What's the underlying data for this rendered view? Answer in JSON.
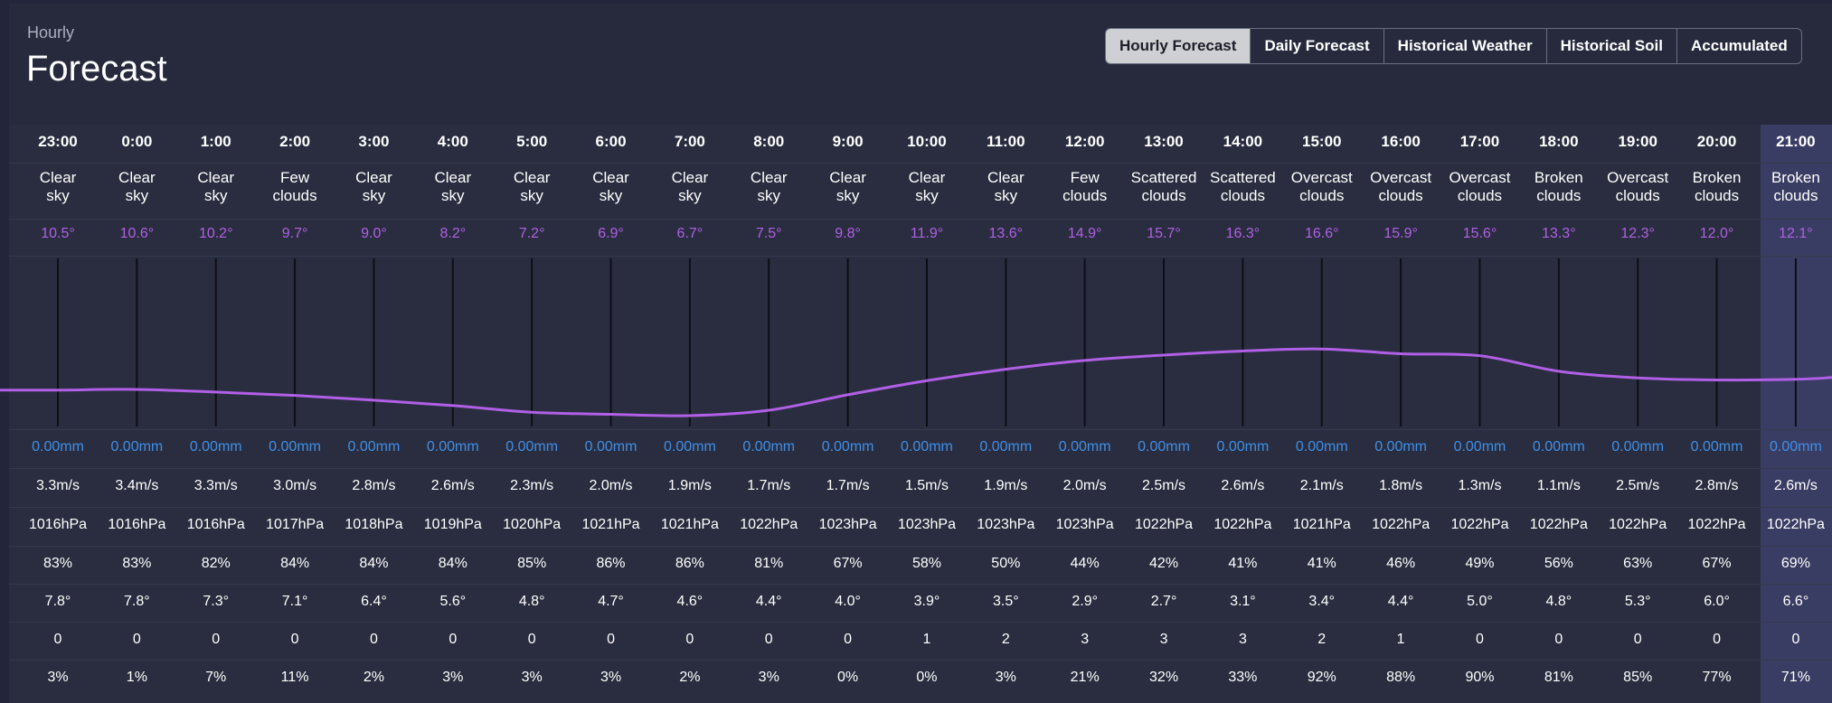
{
  "header": {
    "subtitle": "Hourly",
    "title": "Forecast"
  },
  "tabs": [
    "Hourly Forecast",
    "Daily Forecast",
    "Historical Weather",
    "Historical Soil",
    "Accumulated"
  ],
  "active_tab": "Hourly Forecast",
  "colors": {
    "temperature": "#b15fe6",
    "precipitation": "#3f8fe8",
    "highlight_column": "#3a3d63"
  },
  "hours": [
    {
      "time": "23:00",
      "desc": [
        "Clear",
        "sky"
      ],
      "temp": "10.5°",
      "precip": "0.00mm",
      "wind": "3.3m/s",
      "pressure": "1016hPa",
      "humidity": "83%",
      "dew": "7.8°",
      "uv": "0",
      "clouds": "3%"
    },
    {
      "time": "0:00",
      "desc": [
        "Clear",
        "sky"
      ],
      "temp": "10.6°",
      "precip": "0.00mm",
      "wind": "3.4m/s",
      "pressure": "1016hPa",
      "humidity": "83%",
      "dew": "7.8°",
      "uv": "0",
      "clouds": "1%"
    },
    {
      "time": "1:00",
      "desc": [
        "Clear",
        "sky"
      ],
      "temp": "10.2°",
      "precip": "0.00mm",
      "wind": "3.3m/s",
      "pressure": "1016hPa",
      "humidity": "82%",
      "dew": "7.3°",
      "uv": "0",
      "clouds": "7%"
    },
    {
      "time": "2:00",
      "desc": [
        "Few",
        "clouds"
      ],
      "temp": "9.7°",
      "precip": "0.00mm",
      "wind": "3.0m/s",
      "pressure": "1017hPa",
      "humidity": "84%",
      "dew": "7.1°",
      "uv": "0",
      "clouds": "11%"
    },
    {
      "time": "3:00",
      "desc": [
        "Clear",
        "sky"
      ],
      "temp": "9.0°",
      "precip": "0.00mm",
      "wind": "2.8m/s",
      "pressure": "1018hPa",
      "humidity": "84%",
      "dew": "6.4°",
      "uv": "0",
      "clouds": "2%"
    },
    {
      "time": "4:00",
      "desc": [
        "Clear",
        "sky"
      ],
      "temp": "8.2°",
      "precip": "0.00mm",
      "wind": "2.6m/s",
      "pressure": "1019hPa",
      "humidity": "84%",
      "dew": "5.6°",
      "uv": "0",
      "clouds": "3%"
    },
    {
      "time": "5:00",
      "desc": [
        "Clear",
        "sky"
      ],
      "temp": "7.2°",
      "precip": "0.00mm",
      "wind": "2.3m/s",
      "pressure": "1020hPa",
      "humidity": "85%",
      "dew": "4.8°",
      "uv": "0",
      "clouds": "3%"
    },
    {
      "time": "6:00",
      "desc": [
        "Clear",
        "sky"
      ],
      "temp": "6.9°",
      "precip": "0.00mm",
      "wind": "2.0m/s",
      "pressure": "1021hPa",
      "humidity": "86%",
      "dew": "4.7°",
      "uv": "0",
      "clouds": "3%"
    },
    {
      "time": "7:00",
      "desc": [
        "Clear",
        "sky"
      ],
      "temp": "6.7°",
      "precip": "0.00mm",
      "wind": "1.9m/s",
      "pressure": "1021hPa",
      "humidity": "86%",
      "dew": "4.6°",
      "uv": "0",
      "clouds": "2%"
    },
    {
      "time": "8:00",
      "desc": [
        "Clear",
        "sky"
      ],
      "temp": "7.5°",
      "precip": "0.00mm",
      "wind": "1.7m/s",
      "pressure": "1022hPa",
      "humidity": "81%",
      "dew": "4.4°",
      "uv": "0",
      "clouds": "3%"
    },
    {
      "time": "9:00",
      "desc": [
        "Clear",
        "sky"
      ],
      "temp": "9.8°",
      "precip": "0.00mm",
      "wind": "1.7m/s",
      "pressure": "1023hPa",
      "humidity": "67%",
      "dew": "4.0°",
      "uv": "0",
      "clouds": "0%"
    },
    {
      "time": "10:00",
      "desc": [
        "Clear",
        "sky"
      ],
      "temp": "11.9°",
      "precip": "0.00mm",
      "wind": "1.5m/s",
      "pressure": "1023hPa",
      "humidity": "58%",
      "dew": "3.9°",
      "uv": "1",
      "clouds": "0%"
    },
    {
      "time": "11:00",
      "desc": [
        "Clear",
        "sky"
      ],
      "temp": "13.6°",
      "precip": "0.00mm",
      "wind": "1.9m/s",
      "pressure": "1023hPa",
      "humidity": "50%",
      "dew": "3.5°",
      "uv": "2",
      "clouds": "3%"
    },
    {
      "time": "12:00",
      "desc": [
        "Few",
        "clouds"
      ],
      "temp": "14.9°",
      "precip": "0.00mm",
      "wind": "2.0m/s",
      "pressure": "1023hPa",
      "humidity": "44%",
      "dew": "2.9°",
      "uv": "3",
      "clouds": "21%"
    },
    {
      "time": "13:00",
      "desc": [
        "Scattered",
        "clouds"
      ],
      "temp": "15.7°",
      "precip": "0.00mm",
      "wind": "2.5m/s",
      "pressure": "1022hPa",
      "humidity": "42%",
      "dew": "2.7°",
      "uv": "3",
      "clouds": "32%"
    },
    {
      "time": "14:00",
      "desc": [
        "Scattered",
        "clouds"
      ],
      "temp": "16.3°",
      "precip": "0.00mm",
      "wind": "2.6m/s",
      "pressure": "1022hPa",
      "humidity": "41%",
      "dew": "3.1°",
      "uv": "3",
      "clouds": "33%"
    },
    {
      "time": "15:00",
      "desc": [
        "Overcast",
        "clouds"
      ],
      "temp": "16.6°",
      "precip": "0.00mm",
      "wind": "2.1m/s",
      "pressure": "1021hPa",
      "humidity": "41%",
      "dew": "3.4°",
      "uv": "2",
      "clouds": "92%"
    },
    {
      "time": "16:00",
      "desc": [
        "Overcast",
        "clouds"
      ],
      "temp": "15.9°",
      "precip": "0.00mm",
      "wind": "1.8m/s",
      "pressure": "1022hPa",
      "humidity": "46%",
      "dew": "4.4°",
      "uv": "1",
      "clouds": "88%"
    },
    {
      "time": "17:00",
      "desc": [
        "Overcast",
        "clouds"
      ],
      "temp": "15.6°",
      "precip": "0.00mm",
      "wind": "1.3m/s",
      "pressure": "1022hPa",
      "humidity": "49%",
      "dew": "5.0°",
      "uv": "0",
      "clouds": "90%"
    },
    {
      "time": "18:00",
      "desc": [
        "Broken",
        "clouds"
      ],
      "temp": "13.3°",
      "precip": "0.00mm",
      "wind": "1.1m/s",
      "pressure": "1022hPa",
      "humidity": "56%",
      "dew": "4.8°",
      "uv": "0",
      "clouds": "81%"
    },
    {
      "time": "19:00",
      "desc": [
        "Overcast",
        "clouds"
      ],
      "temp": "12.3°",
      "precip": "0.00mm",
      "wind": "2.5m/s",
      "pressure": "1022hPa",
      "humidity": "63%",
      "dew": "5.3°",
      "uv": "0",
      "clouds": "85%"
    },
    {
      "time": "20:00",
      "desc": [
        "Broken",
        "clouds"
      ],
      "temp": "12.0°",
      "precip": "0.00mm",
      "wind": "2.8m/s",
      "pressure": "1022hPa",
      "humidity": "67%",
      "dew": "6.0°",
      "uv": "0",
      "clouds": "77%"
    },
    {
      "time": "21:00",
      "desc": [
        "Broken",
        "clouds"
      ],
      "temp": "12.1°",
      "precip": "0.00mm",
      "wind": "2.6m/s",
      "pressure": "1022hPa",
      "humidity": "69%",
      "dew": "6.6°",
      "uv": "0",
      "clouds": "71%"
    }
  ],
  "chart_data": {
    "type": "line",
    "x": [
      "23:00",
      "0:00",
      "1:00",
      "2:00",
      "3:00",
      "4:00",
      "5:00",
      "6:00",
      "7:00",
      "8:00",
      "9:00",
      "10:00",
      "11:00",
      "12:00",
      "13:00",
      "14:00",
      "15:00",
      "16:00",
      "17:00",
      "18:00",
      "19:00",
      "20:00",
      "21:00"
    ],
    "series": [
      {
        "values": [
          10.5,
          10.6,
          10.2,
          9.7,
          9.0,
          8.2,
          7.2,
          6.9,
          6.7,
          7.5,
          9.8,
          11.9,
          13.6,
          14.9,
          15.7,
          16.3,
          16.6,
          15.9,
          15.6,
          13.3,
          12.3,
          12.0,
          12.1
        ]
      }
    ],
    "title": "",
    "xlabel": "",
    "ylabel": "",
    "grid": false
  }
}
